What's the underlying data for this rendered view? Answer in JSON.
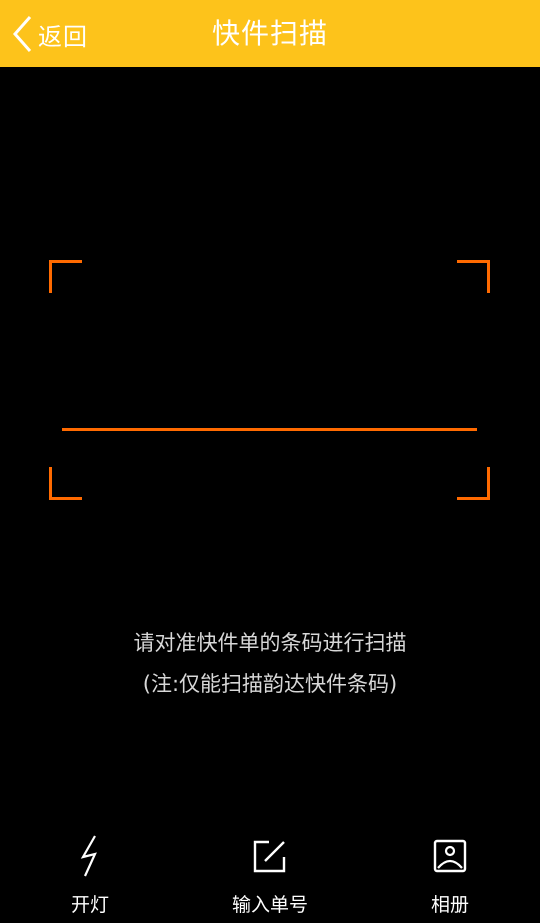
{
  "header": {
    "back_label": "返回",
    "title": "快件扫描"
  },
  "scanner": {
    "hint_line1": "请对准快件单的条码进行扫描",
    "hint_line2": "(注:仅能扫描韵达快件条码)"
  },
  "toolbar": {
    "flash_label": "开灯",
    "manual_label": "输入单号",
    "album_label": "相册"
  },
  "colors": {
    "header_bg": "#FDC31B",
    "accent": "#FF6A00",
    "background": "#000000"
  },
  "icons": {
    "back": "chevron-left-icon",
    "flash": "lightning-icon",
    "manual": "edit-icon",
    "album": "image-icon"
  }
}
